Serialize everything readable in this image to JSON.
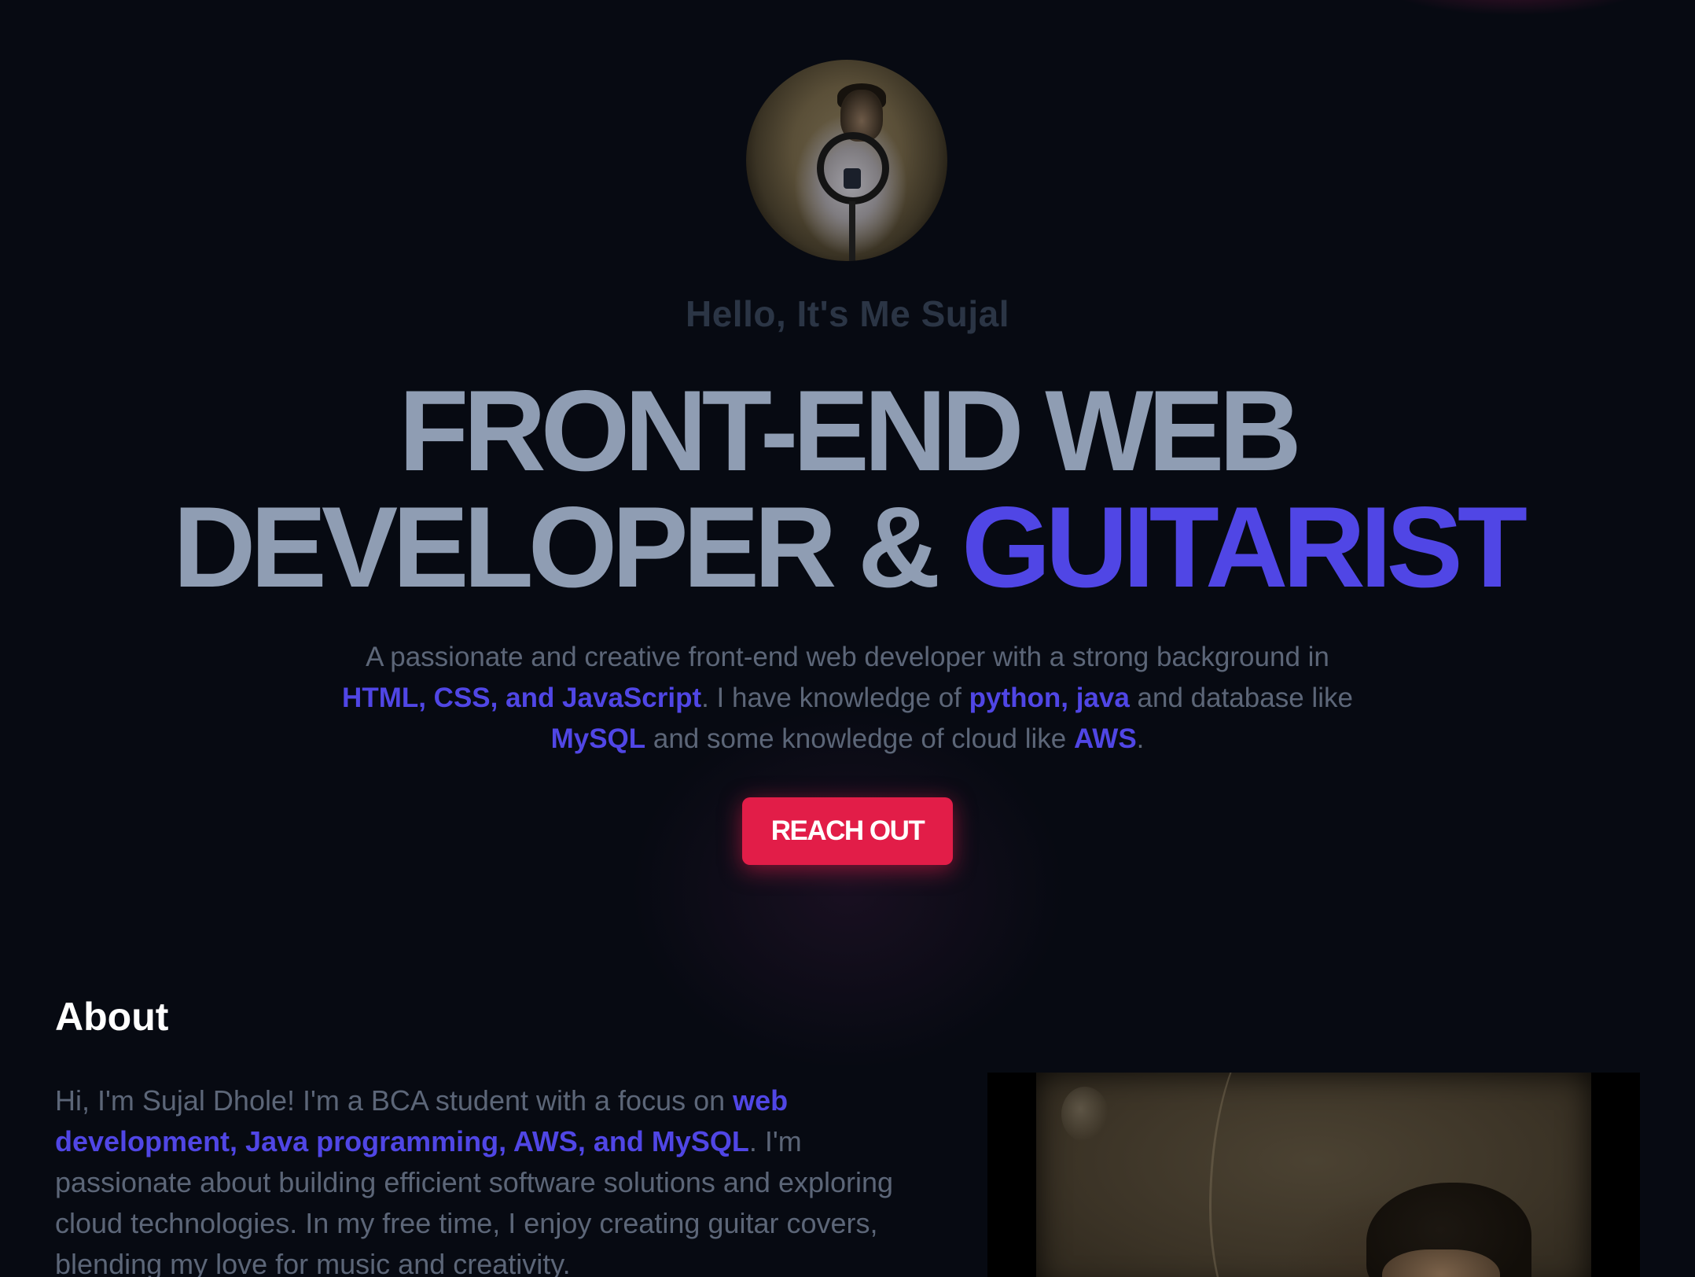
{
  "hero": {
    "greeting": "Hello, It's Me Sujal",
    "title_line1": "FRONT-END WEB",
    "title_line2_prefix": "DEVELOPER & ",
    "title_accent": "GUITARIST",
    "description": {
      "part1": "A passionate and creative front-end web developer with a strong background in ",
      "skills_web": "HTML, CSS, and JavaScript",
      "part2": ". I have knowledge of ",
      "skills_lang": "python, java",
      "part3": " and database like ",
      "skills_db": "MySQL",
      "part4": " and some knowledge of cloud like ",
      "skills_cloud": "AWS",
      "part5": "."
    },
    "cta_label": "REACH OUT"
  },
  "about": {
    "heading": "About",
    "text_part1": "Hi, I'm Sujal Dhole! I'm a BCA student with a focus on ",
    "text_highlight": "web development, Java programming, AWS, and MySQL",
    "text_part2": ". I'm passionate about building efficient software solutions and exploring cloud technologies. In my free time, I enjoy creating guitar covers, blending my love for music and creativity."
  },
  "colors": {
    "background": "#070a12",
    "accent": "#5046e5",
    "cta": "#e21d48",
    "heading_text": "#8f9db3",
    "body_text": "#5c6678"
  }
}
